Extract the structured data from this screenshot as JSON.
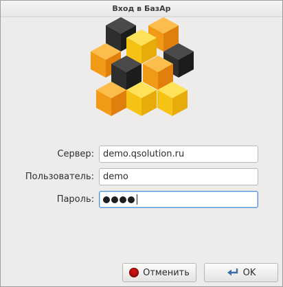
{
  "window": {
    "title": "Вход в БазАр"
  },
  "form": {
    "server_label": "Сервер:",
    "server_value": "demo.qsolution.ru",
    "user_label": "Пользователь:",
    "user_value": "demo",
    "password_label": "Пароль:",
    "password_masked_length": 4
  },
  "buttons": {
    "cancel_label": "Отменить",
    "ok_label": "OK"
  },
  "colors": {
    "cube_orange": "#f5a21e",
    "cube_yellow": "#f7c21a",
    "cube_dark": "#2f2f2f",
    "focus_border": "#4a90d9",
    "cancel_icon": "#c8100f"
  },
  "icons": {
    "cancel": "red-stop-icon",
    "ok": "enter-arrow-icon"
  }
}
